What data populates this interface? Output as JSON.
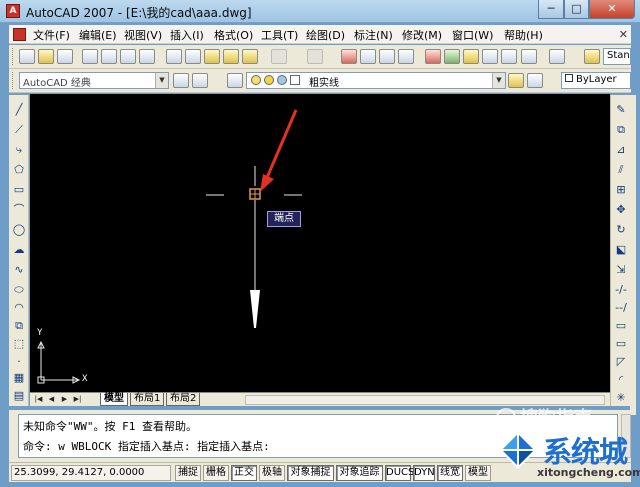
{
  "window": {
    "title": "AutoCAD 2007 - [E:\\我的cad\\aaa.dwg]",
    "minimize": "─",
    "maximize": "□",
    "close": "✕"
  },
  "menu": {
    "items": [
      "文件(F)",
      "编辑(E)",
      "视图(V)",
      "插入(I)",
      "格式(O)",
      "工具(T)",
      "绘图(D)",
      "标注(N)",
      "修改(M)",
      "窗口(W)",
      "帮助(H)"
    ],
    "close_glyph": "✕"
  },
  "toolbar": {
    "workspace": "AutoCAD 经典",
    "layer_name": "粗实线",
    "color_control": "ByLayer",
    "text_style": "Stan"
  },
  "canvas": {
    "tooltip": "端点",
    "ucs_x_label": "X",
    "ucs_y_label": "Y"
  },
  "layout_tabs": {
    "tabs": [
      "模型",
      "布局1",
      "布局2"
    ],
    "active": "模型",
    "nav": [
      "|◀",
      "◀",
      "▶",
      "▶|"
    ]
  },
  "command_line": {
    "history": "未知命令\"WW\"。按 F1 查看帮助。",
    "current": "命令: w WBLOCK 指定插入基点: 指定插入基点:"
  },
  "status_bar": {
    "coordinates": "25.3099, 29.4127, 0.0000",
    "buttons": [
      "捕捉",
      "栅格",
      "正交",
      "极轴",
      "对象捕捉",
      "对象追踪",
      "DUCS",
      "DYN",
      "线宽",
      "模型"
    ]
  },
  "watermark": {
    "top": "搜狗指南",
    "brand": "系统城",
    "url": "xitongcheng.com"
  },
  "colors": {
    "canvas": "#000000",
    "arrow": "#e53124",
    "tooltip_bg": "#23225a",
    "snap_marker": "#e09a4a",
    "brand_blue": "#1d6fd0"
  }
}
